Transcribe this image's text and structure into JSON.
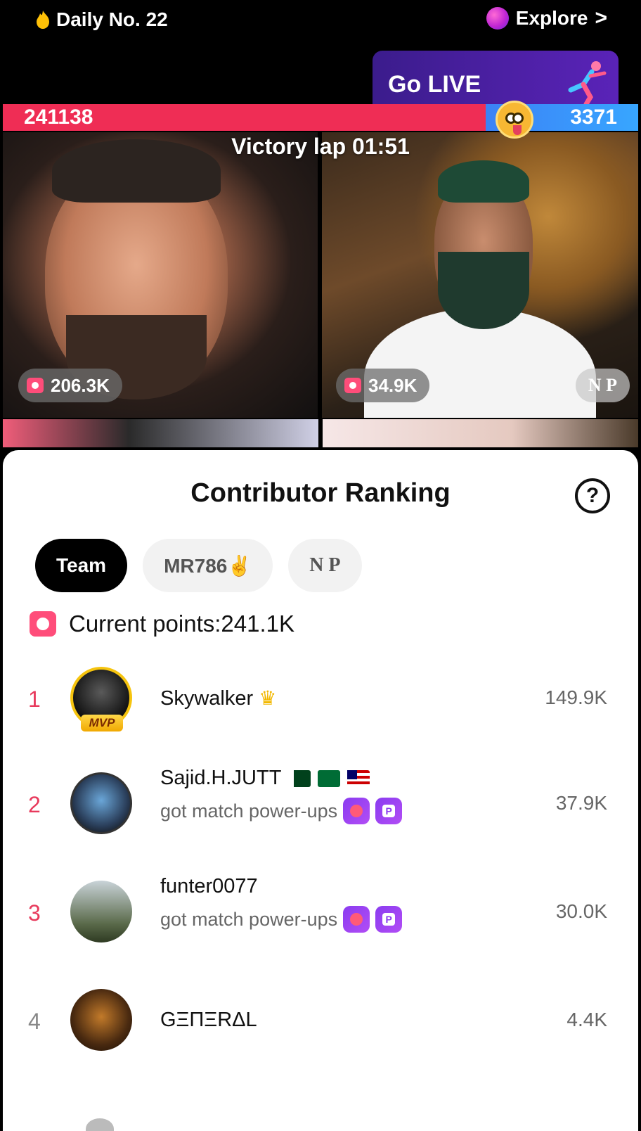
{
  "top": {
    "daily_label": "Daily No. 22",
    "explore_label": "Explore",
    "explore_chevron": ">"
  },
  "go_live": {
    "label": "Go LIVE"
  },
  "battle": {
    "left_score": "241138",
    "right_score": "3371",
    "left_share": 0.76,
    "status": "Victory lap 01:51",
    "left_viewers": "206.3K",
    "right_viewers": "34.9K",
    "right_host_tag": "N P",
    "colors": {
      "left": "#ef2d55",
      "right": "#38a6ff"
    }
  },
  "sheet": {
    "title": "Contributor Ranking",
    "help_icon": "?",
    "tabs": [
      {
        "label": "Team",
        "active": true
      },
      {
        "label": "MR786✌️",
        "active": false
      },
      {
        "label": "N P",
        "active": false
      }
    ],
    "current_points": "Current points:241.1K",
    "ranking": [
      {
        "rank": "1",
        "name": "Skywalker",
        "badge": "MVP",
        "value": "149.9K"
      },
      {
        "rank": "2",
        "name": "Sajid.H.JUTT",
        "sub": "got match power-ups",
        "value": "37.9K"
      },
      {
        "rank": "3",
        "name": "funter0077",
        "sub": "got match power-ups",
        "value": "30.0K"
      },
      {
        "rank": "4",
        "name": "GΞΠΞRΔL",
        "value": "4.4K"
      }
    ]
  },
  "icons": {
    "flame": "flame-icon",
    "explore": "explore-orb-icon",
    "gift": "gift-icon",
    "help": "question-icon",
    "crown": "crown-icon",
    "power_up_glove": "boxing-glove-icon",
    "power_up_p": "p-badge-icon"
  }
}
